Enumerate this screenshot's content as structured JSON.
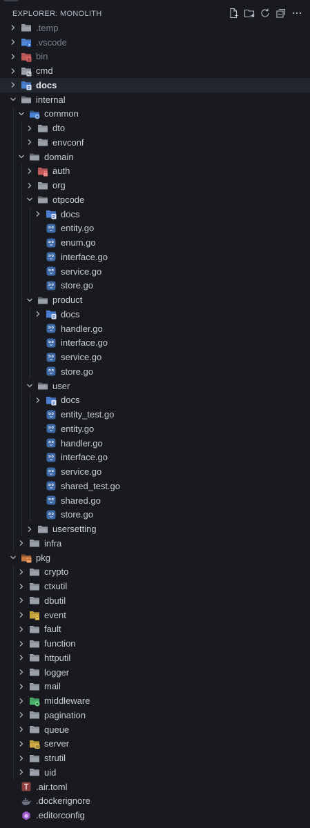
{
  "explorer": {
    "title": "EXPLORER: MONOLITH",
    "actions": [
      {
        "name": "new-file-icon"
      },
      {
        "name": "new-folder-icon"
      },
      {
        "name": "refresh-icon"
      },
      {
        "name": "collapse-all-icon"
      },
      {
        "name": "more-actions-icon"
      }
    ]
  },
  "tree": [
    {
      "label": ".temp",
      "depth": 0,
      "kind": "folder",
      "state": "closed",
      "badge": "",
      "color": "#9aa0aa",
      "dim": true
    },
    {
      "label": ".vscode",
      "depth": 0,
      "kind": "folder",
      "state": "closed",
      "badge": "vscode",
      "color": "#4f86d6",
      "dim": true
    },
    {
      "label": "bin",
      "depth": 0,
      "kind": "folder",
      "state": "closed",
      "badge": "bin",
      "color": "#c45b5b",
      "dim": true
    },
    {
      "label": "cmd",
      "depth": 0,
      "kind": "folder",
      "state": "closed",
      "badge": "cmd",
      "color": "#9aa0aa"
    },
    {
      "label": "docs",
      "depth": 0,
      "kind": "folder",
      "state": "closed",
      "badge": "docs",
      "color": "#4a7fd4",
      "selected": true,
      "strong": true
    },
    {
      "label": "internal",
      "depth": 0,
      "kind": "folder",
      "state": "open",
      "badge": "",
      "color": "#9aa0aa"
    },
    {
      "label": "common",
      "depth": 1,
      "kind": "folder",
      "state": "open",
      "badge": "common",
      "color": "#4a7fd4"
    },
    {
      "label": "dto",
      "depth": 2,
      "kind": "folder",
      "state": "closed",
      "badge": "",
      "color": "#9aa0aa"
    },
    {
      "label": "envconf",
      "depth": 2,
      "kind": "folder",
      "state": "closed",
      "badge": "",
      "color": "#9aa0aa"
    },
    {
      "label": "domain",
      "depth": 1,
      "kind": "folder",
      "state": "open",
      "badge": "",
      "color": "#9aa0aa"
    },
    {
      "label": "auth",
      "depth": 2,
      "kind": "folder",
      "state": "closed",
      "badge": "lock",
      "color": "#c45b5b"
    },
    {
      "label": "org",
      "depth": 2,
      "kind": "folder",
      "state": "closed",
      "badge": "",
      "color": "#9aa0aa"
    },
    {
      "label": "otpcode",
      "depth": 2,
      "kind": "folder",
      "state": "open",
      "badge": "",
      "color": "#9aa0aa"
    },
    {
      "label": "docs",
      "depth": 3,
      "kind": "folder",
      "state": "closed",
      "badge": "docs",
      "color": "#4a7fd4"
    },
    {
      "label": "entity.go",
      "depth": 3,
      "kind": "go"
    },
    {
      "label": "enum.go",
      "depth": 3,
      "kind": "go"
    },
    {
      "label": "interface.go",
      "depth": 3,
      "kind": "go"
    },
    {
      "label": "service.go",
      "depth": 3,
      "kind": "go"
    },
    {
      "label": "store.go",
      "depth": 3,
      "kind": "go"
    },
    {
      "label": "product",
      "depth": 2,
      "kind": "folder",
      "state": "open",
      "badge": "",
      "color": "#9aa0aa"
    },
    {
      "label": "docs",
      "depth": 3,
      "kind": "folder",
      "state": "closed",
      "badge": "docs",
      "color": "#4a7fd4"
    },
    {
      "label": "handler.go",
      "depth": 3,
      "kind": "go"
    },
    {
      "label": "interface.go",
      "depth": 3,
      "kind": "go"
    },
    {
      "label": "service.go",
      "depth": 3,
      "kind": "go"
    },
    {
      "label": "store.go",
      "depth": 3,
      "kind": "go"
    },
    {
      "label": "user",
      "depth": 2,
      "kind": "folder",
      "state": "open",
      "badge": "",
      "color": "#9aa0aa"
    },
    {
      "label": "docs",
      "depth": 3,
      "kind": "folder",
      "state": "closed",
      "badge": "docs",
      "color": "#4a7fd4"
    },
    {
      "label": "entity_test.go",
      "depth": 3,
      "kind": "go"
    },
    {
      "label": "entity.go",
      "depth": 3,
      "kind": "go"
    },
    {
      "label": "handler.go",
      "depth": 3,
      "kind": "go"
    },
    {
      "label": "interface.go",
      "depth": 3,
      "kind": "go"
    },
    {
      "label": "service.go",
      "depth": 3,
      "kind": "go"
    },
    {
      "label": "shared_test.go",
      "depth": 3,
      "kind": "go"
    },
    {
      "label": "shared.go",
      "depth": 3,
      "kind": "go"
    },
    {
      "label": "store.go",
      "depth": 3,
      "kind": "go"
    },
    {
      "label": "usersetting",
      "depth": 2,
      "kind": "folder",
      "state": "closed",
      "badge": "",
      "color": "#9aa0aa"
    },
    {
      "label": "infra",
      "depth": 1,
      "kind": "folder",
      "state": "closed",
      "badge": "",
      "color": "#9aa0aa"
    },
    {
      "label": "pkg",
      "depth": 0,
      "kind": "folder",
      "state": "open",
      "badge": "pkg",
      "color": "#c9783d"
    },
    {
      "label": "crypto",
      "depth": 1,
      "kind": "folder",
      "state": "closed",
      "badge": "",
      "color": "#9aa0aa"
    },
    {
      "label": "ctxutil",
      "depth": 1,
      "kind": "folder",
      "state": "closed",
      "badge": "",
      "color": "#9aa0aa"
    },
    {
      "label": "dbutil",
      "depth": 1,
      "kind": "folder",
      "state": "closed",
      "badge": "",
      "color": "#9aa0aa"
    },
    {
      "label": "event",
      "depth": 1,
      "kind": "folder",
      "state": "closed",
      "badge": "event",
      "color": "#c9a53d"
    },
    {
      "label": "fault",
      "depth": 1,
      "kind": "folder",
      "state": "closed",
      "badge": "",
      "color": "#9aa0aa"
    },
    {
      "label": "function",
      "depth": 1,
      "kind": "folder",
      "state": "closed",
      "badge": "",
      "color": "#9aa0aa"
    },
    {
      "label": "httputil",
      "depth": 1,
      "kind": "folder",
      "state": "closed",
      "badge": "",
      "color": "#9aa0aa"
    },
    {
      "label": "logger",
      "depth": 1,
      "kind": "folder",
      "state": "closed",
      "badge": "",
      "color": "#9aa0aa"
    },
    {
      "label": "mail",
      "depth": 1,
      "kind": "folder",
      "state": "closed",
      "badge": "",
      "color": "#9aa0aa"
    },
    {
      "label": "middleware",
      "depth": 1,
      "kind": "folder",
      "state": "closed",
      "badge": "middleware",
      "color": "#4caf6a"
    },
    {
      "label": "pagination",
      "depth": 1,
      "kind": "folder",
      "state": "closed",
      "badge": "",
      "color": "#9aa0aa"
    },
    {
      "label": "queue",
      "depth": 1,
      "kind": "folder",
      "state": "closed",
      "badge": "",
      "color": "#9aa0aa"
    },
    {
      "label": "server",
      "depth": 1,
      "kind": "folder",
      "state": "closed",
      "badge": "server",
      "color": "#c9a53d"
    },
    {
      "label": "strutil",
      "depth": 1,
      "kind": "folder",
      "state": "closed",
      "badge": "",
      "color": "#9aa0aa"
    },
    {
      "label": "uid",
      "depth": 1,
      "kind": "folder",
      "state": "closed",
      "badge": "",
      "color": "#9aa0aa"
    },
    {
      "label": ".air.toml",
      "depth": 0,
      "kind": "toml",
      "dim": false
    },
    {
      "label": ".dockerignore",
      "depth": 0,
      "kind": "docker"
    },
    {
      "label": ".editorconfig",
      "depth": 0,
      "kind": "editorconfig"
    }
  ]
}
